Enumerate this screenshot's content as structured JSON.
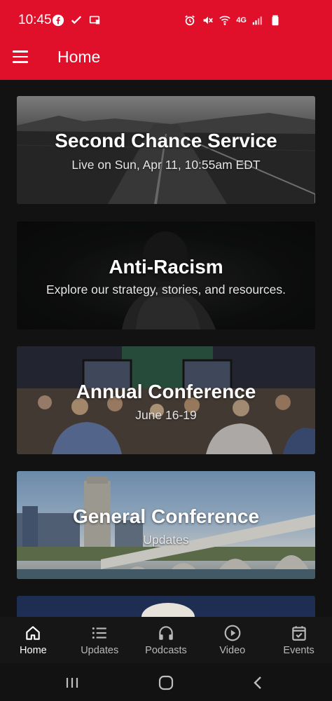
{
  "status_bar": {
    "time": "10:45",
    "network_label": "4G",
    "left_icons": [
      "facebook-icon",
      "check-icon",
      "cast-icon"
    ],
    "right_icons": [
      "alarm-icon",
      "mute-icon",
      "wifi-icon",
      "signal-icon",
      "battery-icon"
    ]
  },
  "app_bar": {
    "title": "Home",
    "menu_icon": "hamburger-menu-icon",
    "background_color": "#e0102a"
  },
  "cards": [
    {
      "title": "Second Chance Service",
      "subtitle": "Live on Sun, Apr 11, 10:55am EDT",
      "image": "road-landscape-image"
    },
    {
      "title": "Anti-Racism",
      "subtitle": "Explore our strategy, stories, and resources.",
      "image": "portrait-dark-image"
    },
    {
      "title": "Annual Conference",
      "subtitle": "June 16-19",
      "image": "conference-hall-image"
    },
    {
      "title": "General Conference",
      "subtitle": "Updates",
      "image": "city-bridge-image"
    },
    {
      "title": "",
      "subtitle": "",
      "image": "person-portrait-image"
    }
  ],
  "bottom_nav": {
    "items": [
      {
        "label": "Home",
        "icon": "home-icon",
        "active": true
      },
      {
        "label": "Updates",
        "icon": "list-icon",
        "active": false
      },
      {
        "label": "Podcasts",
        "icon": "headphones-icon",
        "active": false
      },
      {
        "label": "Video",
        "icon": "play-circle-icon",
        "active": false
      },
      {
        "label": "Events",
        "icon": "calendar-check-icon",
        "active": false
      }
    ]
  },
  "system_nav": {
    "icons": [
      "recent-apps-icon",
      "home-circle-icon",
      "back-icon"
    ]
  }
}
